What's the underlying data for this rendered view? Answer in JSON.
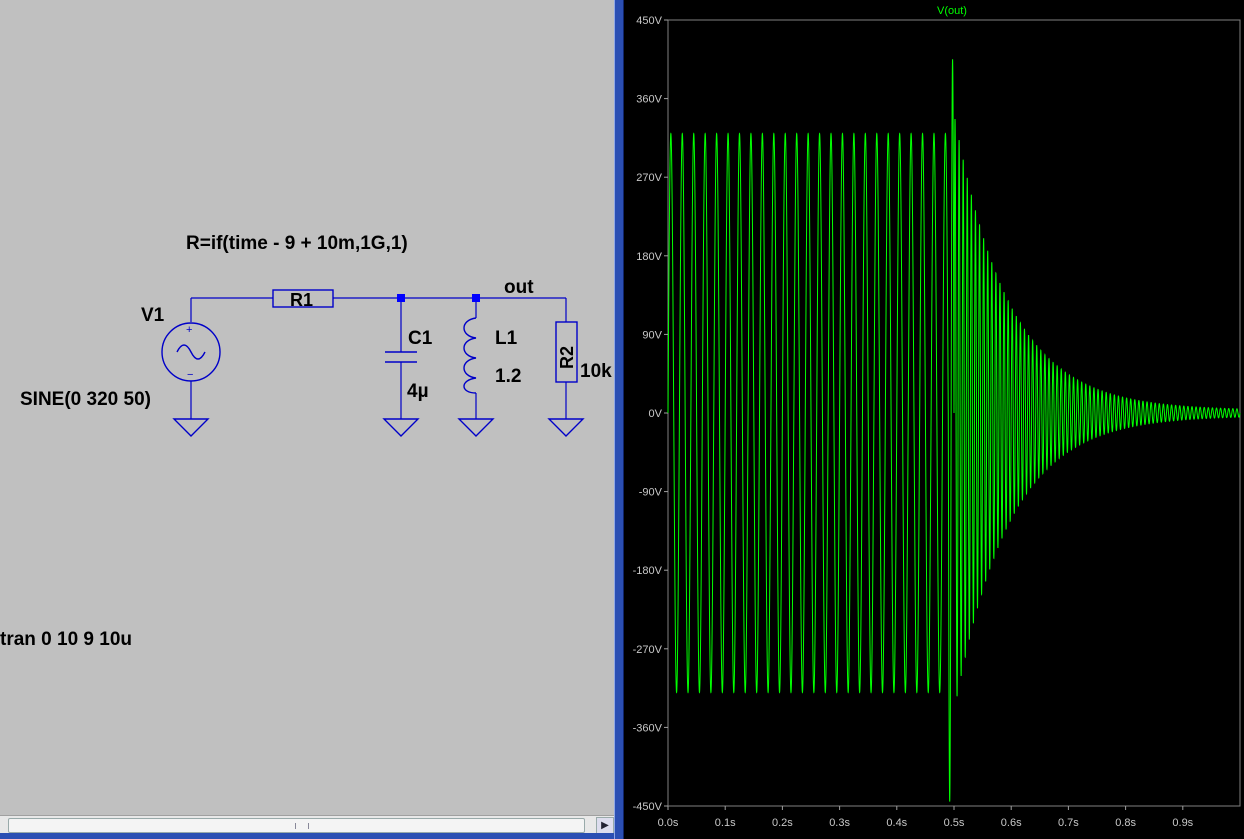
{
  "schematic": {
    "r1_expression": "R=if(time - 9 + 10m,1G,1)",
    "v1_name": "V1",
    "v1_value": "SINE(0 320 50)",
    "r1_name": "R1",
    "c1_name": "C1",
    "c1_value": "4µ",
    "l1_name": "L1",
    "l1_value": "1.2",
    "r2_name": "R2",
    "r2_value": "10k",
    "net_label": "out",
    "directive": "tran 0 10 9 10u",
    "colors": {
      "wire": "#0000c8",
      "node": "#0000ff",
      "text": "#000000",
      "background": "#c0c0c0"
    }
  },
  "chart_data": {
    "type": "line",
    "title": "V(out)",
    "xlabel": "",
    "ylabel": "",
    "x_ticks": [
      "0.0s",
      "0.1s",
      "0.2s",
      "0.3s",
      "0.4s",
      "0.5s",
      "0.6s",
      "0.7s",
      "0.8s",
      "0.9s"
    ],
    "y_ticks": [
      "450V",
      "360V",
      "270V",
      "180V",
      "90V",
      "0V",
      "-90V",
      "-180V",
      "-270V",
      "-360V",
      "-450V"
    ],
    "xlim": [
      0,
      1.0
    ],
    "ylim": [
      -450,
      450
    ],
    "grid": false,
    "series": [
      {
        "name": "V(out)",
        "color": "#00ff00",
        "segments": [
          {
            "from_s": 0.0,
            "to_s": 0.49,
            "shape": "sine",
            "amplitude_v": 320,
            "frequency_hz": 50
          },
          {
            "from_s": 0.49,
            "to_s": 0.5,
            "shape": "transient",
            "peak_v": 405,
            "trough_v": -445
          },
          {
            "from_s": 0.5,
            "to_s": 1.0,
            "shape": "decaying sine",
            "initial_amplitude_v": 340,
            "frequency_hz": 140,
            "final_amplitude_v": 3
          }
        ]
      }
    ]
  }
}
